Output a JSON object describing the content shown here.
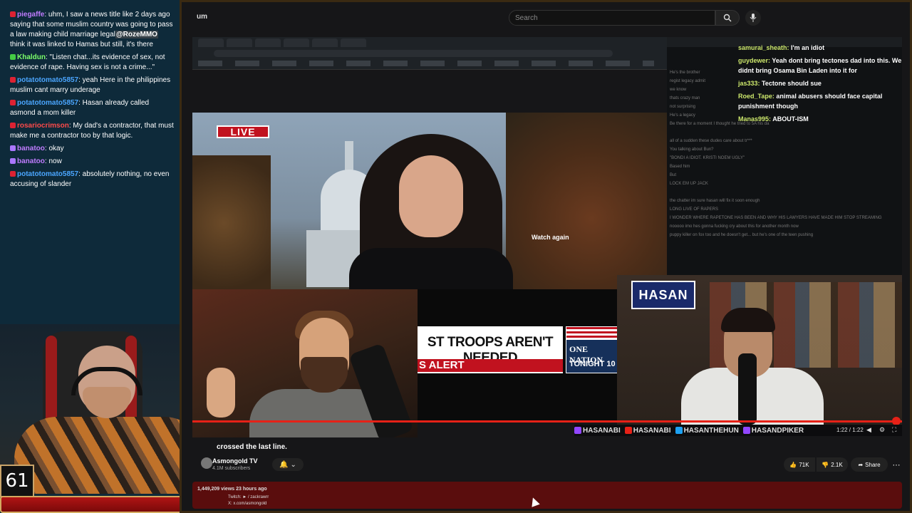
{
  "left_chat": [
    {
      "user": "piegaffe",
      "user_color": "purple",
      "badge": "red",
      "text": ": uhm, I saw a news title like 2 days ago saying that some muslim country was going to pass a law making child marriage legal",
      "mention": "@RozeMMO",
      "text2": " think it was linked to Hamas but still, it's there"
    },
    {
      "user": "Khaldun",
      "user_color": "green",
      "badge": "green",
      "text": ": \"Listen chat...its evidence of sex, not evidence of rape. Having sex is not a crime...\"",
      "mention": "",
      "text2": ""
    },
    {
      "user": "potatotomato5857",
      "user_color": "blue",
      "badge": "red",
      "text": ": yeah Here in the philippines muslim cant marry underage",
      "mention": "",
      "text2": ""
    },
    {
      "user": "potatotomato5857",
      "user_color": "blue",
      "badge": "red",
      "text": ": Hasan already called asmond a mom killer",
      "mention": "",
      "text2": ""
    },
    {
      "user": "rosariocrimson",
      "user_color": "red",
      "badge": "red",
      "text": ": My dad's a contractor, that must make me a contractor too by that logic.",
      "mention": "",
      "text2": ""
    },
    {
      "user": "banatoo",
      "user_color": "purple",
      "badge": "purple",
      "text": ": okay",
      "mention": "",
      "text2": ""
    },
    {
      "user": "banatoo",
      "user_color": "purple",
      "badge": "purple",
      "text": ": now",
      "mention": "",
      "text2": ""
    },
    {
      "user": "potatotomato5857",
      "user_color": "blue",
      "badge": "red",
      "text": ": absolutely nothing, no even accusing of slander",
      "mention": "",
      "text2": ""
    }
  ],
  "counter": "61",
  "yt": {
    "search_placeholder": "Search",
    "logo_suffix": "um"
  },
  "video": {
    "live_label": "LIVE",
    "watch_again": "Watch again",
    "chyron": "ST TROOPS AREN'T NEEDED",
    "alert": "S ALERT",
    "network_name": "ONE NATION",
    "network_time": "TONIGHT 10",
    "hasan_logo": "HASAN",
    "caption": "crossed the last line.",
    "time": "1:22 / 1:22",
    "progress": 1.0
  },
  "right_chat_overlay": [
    {
      "user": "samurai_sheath:",
      "text": "I'm an idiot"
    },
    {
      "user": "guydewer:",
      "text": "Yeah dont bring tectones dad into this. We didnt bring Osama Bin Laden into it for"
    },
    {
      "user": "jas333:",
      "text": "Tectone should sue"
    },
    {
      "user": "Roed_Tape:",
      "text": "animal abusers should face capital punishment though"
    },
    {
      "user": "Manas995:",
      "text": "ABOUT-ISM"
    }
  ],
  "right_chat_faded": [
    "He's the brother",
    "regist legacy admit",
    "we know",
    "thats crazy man",
    "not surprising",
    "He's a legacy",
    "Be there for a moment I thought he tried to 5A his da",
    "",
    "all of a sudden these dudes care about tr***",
    "You talking about Bun?",
    "\"BONDI A IDIOT. KRISTI NOEM UGLY\"",
    "Based him",
    "But",
    "LOCK EM UP JACK",
    "",
    "the chatter im sure hasan will fix it soon enough",
    "LONG LIVE OF RAPERS",
    "I WONDER WHERE RAPETONE HAS BEEN AND WHY HIS LAWYERS HAVE MADE HIM STOP STREAMING",
    "nooooo imo hes gonna fucking cry about this for another month now",
    "puppy killer on fox too and he doesn't get... but he's one of the teen pushing"
  ],
  "socials": [
    "HASANABI",
    "HASANABI",
    "HASANTHEHUN",
    "HASANDPIKER"
  ],
  "channel": {
    "name": "Asmongold TV",
    "subs": "4.1M subscribers",
    "likes": "71K",
    "dislikes": "2.1K",
    "share": "Share",
    "views": "1,449,209 views  23 hours ago",
    "desc1": "Twitch: ► / zackrawrr",
    "desc2": "X: x.com/asmongold"
  }
}
